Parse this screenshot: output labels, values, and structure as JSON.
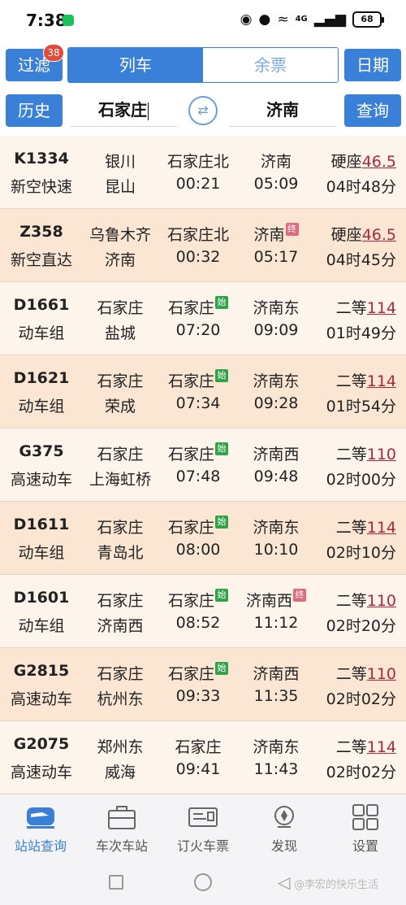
{
  "status_bar": {
    "time": "7:38",
    "network": "4G",
    "battery": "68"
  },
  "toolbar": {
    "filter_label": "过滤",
    "filter_badge": "38",
    "tab_trains": "列车",
    "tab_tickets": "余票",
    "date_label": "日期",
    "history_label": "历史",
    "from_station": "石家庄",
    "to_station": "济南",
    "query_label": "查询"
  },
  "trains": [
    {
      "code": "K1334",
      "type": "新空快速",
      "from": "银川",
      "to": "昆山",
      "dep_station": "石家庄北",
      "dep_time": "00:21",
      "arr_station": "济南",
      "arr_time": "05:09",
      "seat": "硬座",
      "price": "46.5",
      "duration": "04时48分",
      "start_tag": "",
      "end_tag": ""
    },
    {
      "code": "Z358",
      "type": "新空直达",
      "from": "乌鲁木齐",
      "to": "济南",
      "dep_station": "石家庄北",
      "dep_time": "00:32",
      "arr_station": "济南",
      "arr_time": "05:17",
      "seat": "硬座",
      "price": "46.5",
      "duration": "04时45分",
      "start_tag": "",
      "end_tag": "终"
    },
    {
      "code": "D1661",
      "type": "动车组",
      "from": "石家庄",
      "to": "盐城",
      "dep_station": "石家庄",
      "dep_time": "07:20",
      "arr_station": "济南东",
      "arr_time": "09:09",
      "seat": "二等",
      "price": "114",
      "duration": "01时49分",
      "start_tag": "始",
      "end_tag": ""
    },
    {
      "code": "D1621",
      "type": "动车组",
      "from": "石家庄",
      "to": "荣成",
      "dep_station": "石家庄",
      "dep_time": "07:34",
      "arr_station": "济南东",
      "arr_time": "09:28",
      "seat": "二等",
      "price": "114",
      "duration": "01时54分",
      "start_tag": "始",
      "end_tag": ""
    },
    {
      "code": "G375",
      "type": "高速动车",
      "from": "石家庄",
      "to": "上海虹桥",
      "dep_station": "石家庄",
      "dep_time": "07:48",
      "arr_station": "济南西",
      "arr_time": "09:48",
      "seat": "二等",
      "price": "110",
      "duration": "02时00分",
      "start_tag": "始",
      "end_tag": ""
    },
    {
      "code": "D1611",
      "type": "动车组",
      "from": "石家庄",
      "to": "青岛北",
      "dep_station": "石家庄",
      "dep_time": "08:00",
      "arr_station": "济南东",
      "arr_time": "10:10",
      "seat": "二等",
      "price": "114",
      "duration": "02时10分",
      "start_tag": "始",
      "end_tag": ""
    },
    {
      "code": "D1601",
      "type": "动车组",
      "from": "石家庄",
      "to": "济南西",
      "dep_station": "石家庄",
      "dep_time": "08:52",
      "arr_station": "济南西",
      "arr_time": "11:12",
      "seat": "二等",
      "price": "110",
      "duration": "02时20分",
      "start_tag": "始",
      "end_tag": "终"
    },
    {
      "code": "G2815",
      "type": "高速动车",
      "from": "石家庄",
      "to": "杭州东",
      "dep_station": "石家庄",
      "dep_time": "09:33",
      "arr_station": "济南西",
      "arr_time": "11:35",
      "seat": "二等",
      "price": "110",
      "duration": "02时02分",
      "start_tag": "始",
      "end_tag": ""
    },
    {
      "code": "G2075",
      "type": "高速动车",
      "from": "郑州东",
      "to": "威海",
      "dep_station": "石家庄",
      "dep_time": "09:41",
      "arr_station": "济南东",
      "arr_time": "11:43",
      "seat": "二等",
      "price": "114",
      "duration": "02时02分",
      "start_tag": "",
      "end_tag": ""
    }
  ],
  "bottom_nav": [
    {
      "label": "站站查询",
      "icon": "train-icon",
      "active": true
    },
    {
      "label": "车次车站",
      "icon": "suitcase-icon",
      "active": false
    },
    {
      "label": "订火车票",
      "icon": "ticket-icon",
      "active": false
    },
    {
      "label": "发现",
      "icon": "compass-icon",
      "active": false
    },
    {
      "label": "设置",
      "icon": "grid-icon",
      "active": false
    }
  ],
  "watermark": "@李宏的快乐生活",
  "colors": {
    "accent": "#3a7fd8",
    "price": "#b3263c",
    "row_light": "#fdf4ec",
    "row_dark": "#fbe6d4",
    "start_tag": "#2fa34a",
    "end_tag": "#e06a7a"
  }
}
